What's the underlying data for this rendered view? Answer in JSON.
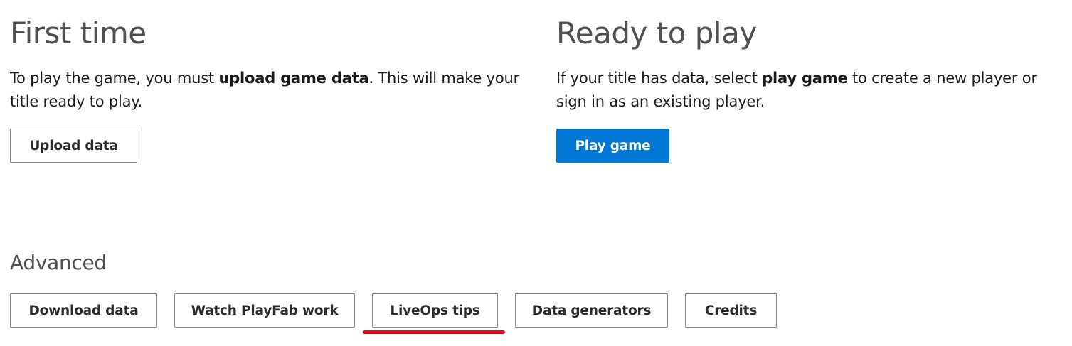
{
  "first_time": {
    "title": "First time",
    "desc_pre": "To play the game, you must ",
    "desc_bold": "upload game data",
    "desc_post": ". This will make your title ready to play.",
    "upload_button": "Upload data"
  },
  "ready_to_play": {
    "title": "Ready to play",
    "desc_pre": "If your title has data, select ",
    "desc_bold": "play game",
    "desc_post": " to create a new player or sign in as an existing player.",
    "play_button": "Play game"
  },
  "advanced": {
    "title": "Advanced",
    "buttons": [
      "Download data",
      "Watch PlayFab work",
      "LiveOps tips",
      "Data generators",
      "Credits"
    ]
  },
  "colors": {
    "primary": "#0078d4",
    "annotation": "#e8111a",
    "heading": "#505050"
  }
}
